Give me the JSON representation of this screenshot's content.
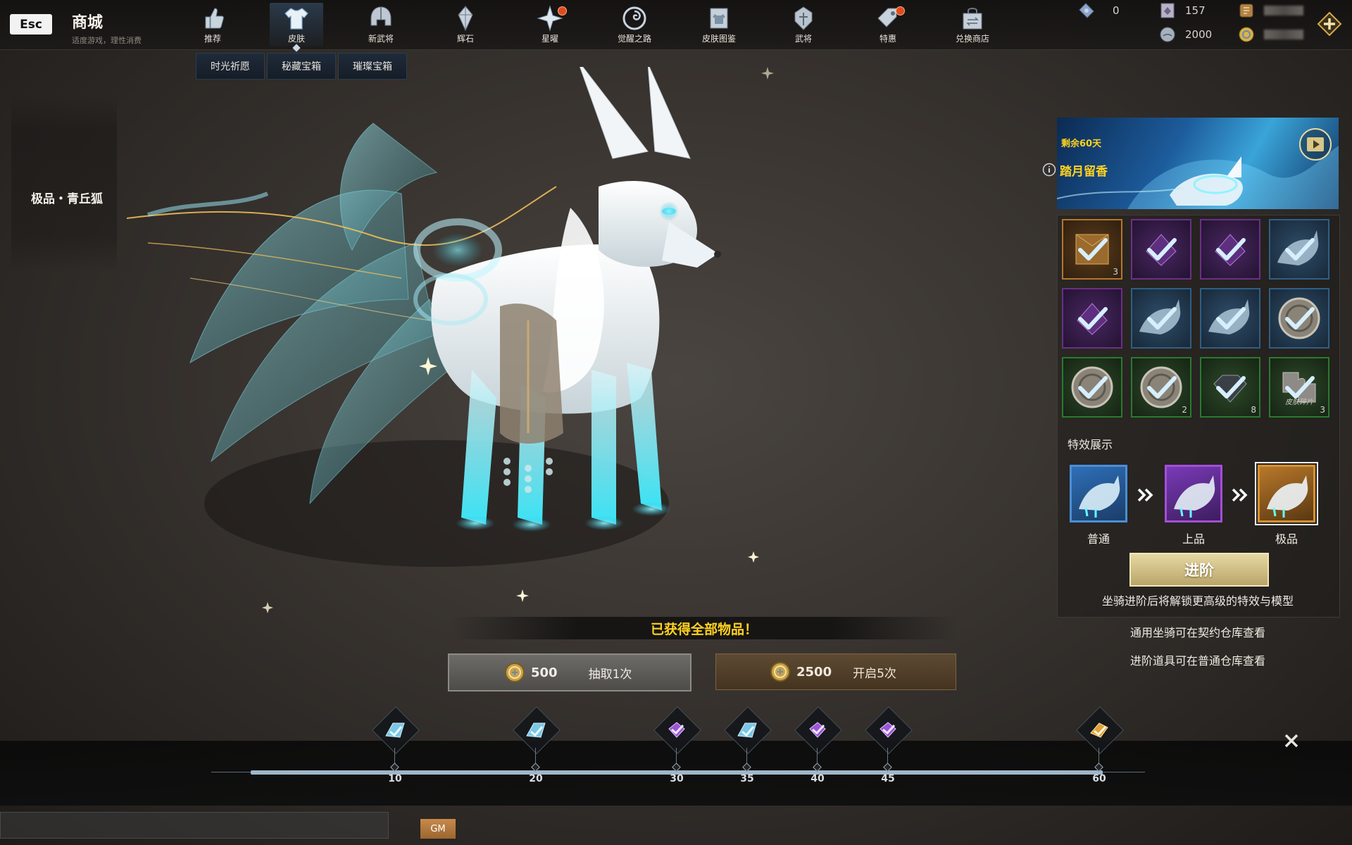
{
  "header": {
    "esc_label": "Esc",
    "title": "商城",
    "subtitle": "适度游戏，理性消费"
  },
  "nav": [
    {
      "label": "推荐",
      "icon": "thumbs-up-icon"
    },
    {
      "label": "皮肤",
      "icon": "shirt-icon",
      "active": true
    },
    {
      "label": "新武将",
      "icon": "helmet-icon"
    },
    {
      "label": "辉石",
      "icon": "crystal-icon"
    },
    {
      "label": "星曜",
      "icon": "star-icon",
      "badge": true
    },
    {
      "label": "觉醒之路",
      "icon": "swirl-icon"
    },
    {
      "label": "皮肤图鉴",
      "icon": "book-icon"
    },
    {
      "label": "武将",
      "icon": "warrior-helmet-icon"
    },
    {
      "label": "特惠",
      "icon": "tag-icon",
      "badge": true
    },
    {
      "label": "兑换商店",
      "icon": "shop-bag-icon"
    }
  ],
  "currencies": {
    "ticket": "0",
    "card": "157",
    "moon": "2000",
    "scroll": "",
    "gold": ""
  },
  "subtabs": [
    "时光祈愿",
    "秘藏宝箱",
    "璀璨宝箱"
  ],
  "item_name": "极品・青丘狐",
  "banner": {
    "remaining": "剩余60天",
    "title": "踏月留香"
  },
  "rewards": [
    {
      "quality": "orange",
      "icon": "scroll-box-icon",
      "count": "3"
    },
    {
      "quality": "purple",
      "icon": "purple-crystal-icon",
      "count": ""
    },
    {
      "quality": "purple",
      "icon": "purple-crystal-icon",
      "count": ""
    },
    {
      "quality": "blue",
      "icon": "fox-mount-icon",
      "count": ""
    },
    {
      "quality": "purple",
      "icon": "purple-crystal-icon",
      "count": ""
    },
    {
      "quality": "blue",
      "icon": "fox-mount-icon",
      "count": ""
    },
    {
      "quality": "blue",
      "icon": "fox-mount-icon",
      "count": ""
    },
    {
      "quality": "blue",
      "icon": "shield-emblem-icon",
      "count": ""
    },
    {
      "quality": "green",
      "icon": "coin-emblem-icon",
      "count": ""
    },
    {
      "quality": "green",
      "icon": "coin-emblem-icon",
      "count": "2"
    },
    {
      "quality": "green",
      "icon": "diamond-icon",
      "count": "8"
    },
    {
      "quality": "green",
      "icon": "skin-fragment-icon",
      "count": "3",
      "caption": "皮肤碎片"
    }
  ],
  "fx": {
    "title": "特效展示",
    "levels": [
      {
        "label": "普通",
        "color": "#4a8fd6"
      },
      {
        "label": "上品",
        "color": "#a34fd6"
      },
      {
        "label": "极品",
        "color": "#d6922f"
      }
    ]
  },
  "advance": {
    "label": "进阶",
    "hint": "坐骑进阶后将解锁更高级的特效与模型"
  },
  "notes": [
    "通用坐骑可在契约仓库查看",
    "进阶道具可在普通仓库查看"
  ],
  "obtained_text": "已获得全部物品！",
  "draw": {
    "one": {
      "amount": "500",
      "action": "抽取1次"
    },
    "five": {
      "amount": "2500",
      "action": "开启5次"
    }
  },
  "milestones": [
    {
      "value": "10",
      "icon": "fox-gem-icon"
    },
    {
      "value": "20",
      "icon": "fox-gem-icon"
    },
    {
      "value": "30",
      "icon": "purple-gem-icon"
    },
    {
      "value": "35",
      "icon": "fox-gem-icon"
    },
    {
      "value": "40",
      "icon": "purple-gem-icon"
    },
    {
      "value": "45",
      "icon": "purple-gem-icon"
    },
    {
      "value": "60",
      "icon": "gold-gem-icon"
    }
  ],
  "gm_label": "GM",
  "colors": {
    "accent_gold": "#ffd21f",
    "bg": "#3a3531"
  }
}
